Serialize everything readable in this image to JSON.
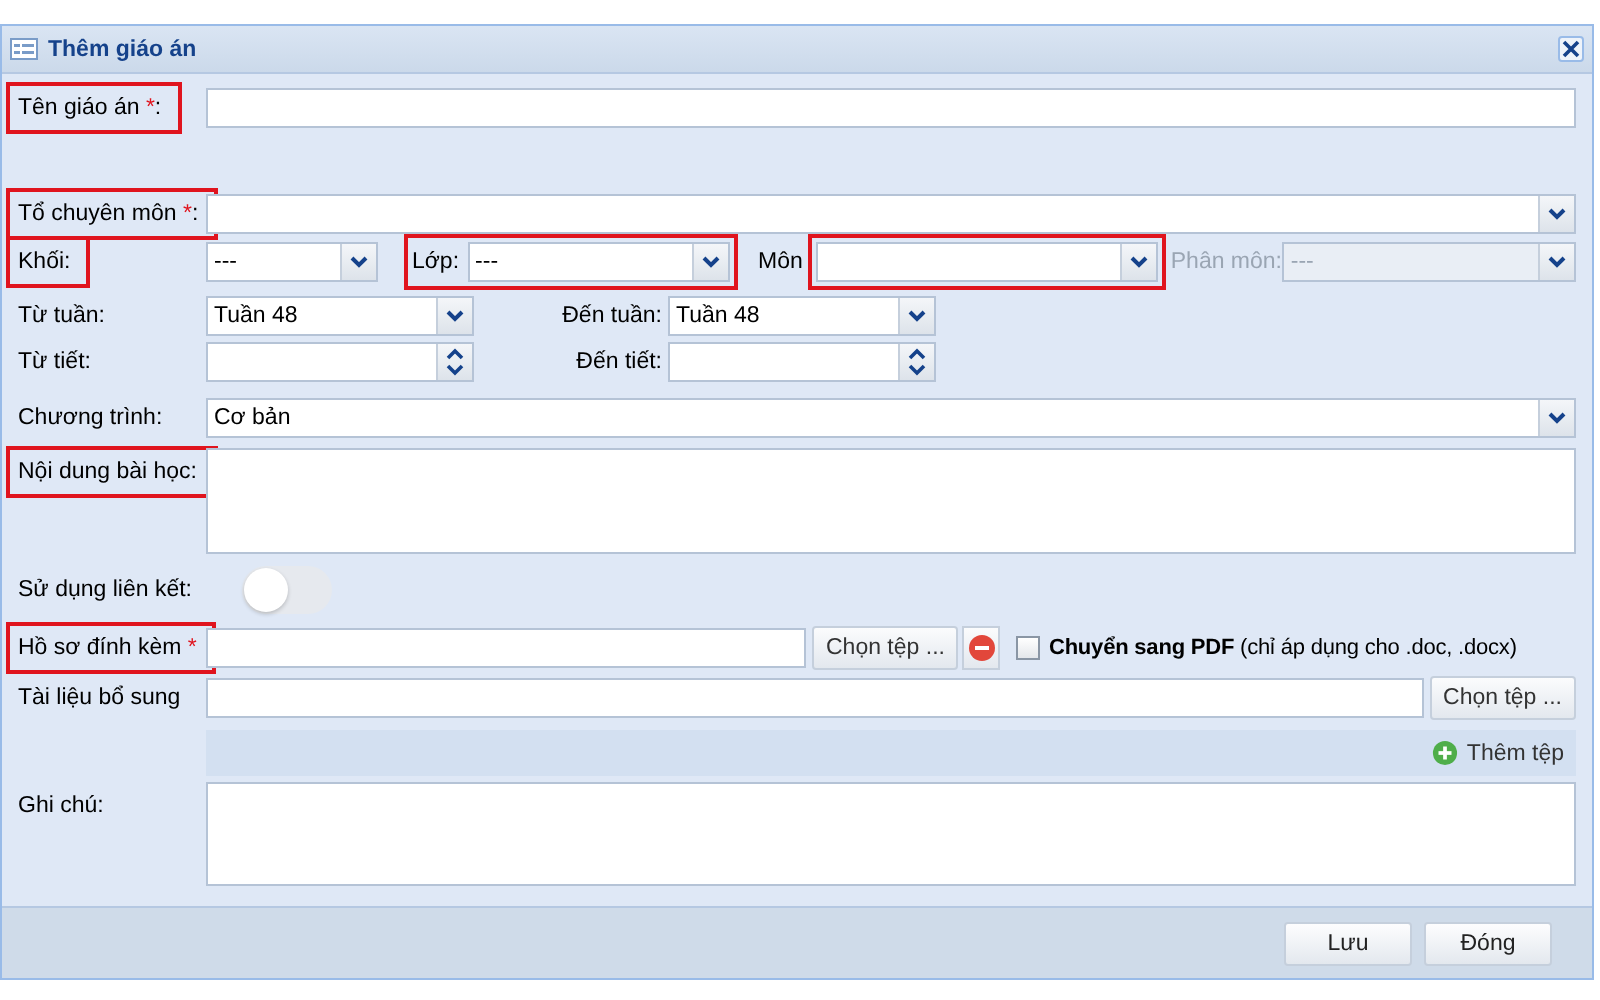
{
  "window": {
    "title": "Thêm giáo án"
  },
  "ten_giao_an": {
    "label": "Tên giáo án ",
    "required_mark": "*",
    "label_end": ":",
    "highlighted": true
  },
  "to_chuyen_mon": {
    "label": "Tổ chuyên môn ",
    "required_mark": "*",
    "label_end": ":",
    "highlighted": true
  },
  "khoi": {
    "label": "Khối:",
    "value": "---",
    "highlighted": true
  },
  "lop": {
    "label": "Lớp:",
    "value": "---",
    "highlighted": true
  },
  "mon": {
    "label": "Môn",
    "highlighted": true
  },
  "phan_mon": {
    "label": "Phân môn:",
    "value": "---",
    "disabled": true
  },
  "tu_tuan": {
    "label": "Từ tuần:",
    "value": "Tuần 48"
  },
  "den_tuan": {
    "label": "Đến tuần:",
    "value": "Tuần 48"
  },
  "tu_tiet": {
    "label": "Từ tiết:"
  },
  "den_tiet": {
    "label": "Đến tiết:"
  },
  "chuong_trinh": {
    "label": "Chương trình:",
    "value": "Cơ bản"
  },
  "noi_dung": {
    "label": "Nội dung bài học:",
    "highlighted": true
  },
  "su_dung_lien_ket": {
    "label": "Sử dụng liên kết:",
    "on": false
  },
  "ho_so": {
    "label": "Hồ sơ đính kèm ",
    "required_mark": "*",
    "highlighted": true,
    "choose_button": "Chọn tệp ...",
    "convert_pdf": {
      "checked": false,
      "text": "**Chuyển sang PDF** (chỉ áp dụng cho .doc, .docx)"
    }
  },
  "tai_lieu": {
    "label": "Tài liệu bổ sung",
    "choose_button": "Chọn tệp ...",
    "add_button": "Thêm tệp"
  },
  "ghi_chu": {
    "label": "Ghi chú:"
  },
  "buttons": [
    "Lưu",
    "Đóng"
  ]
}
